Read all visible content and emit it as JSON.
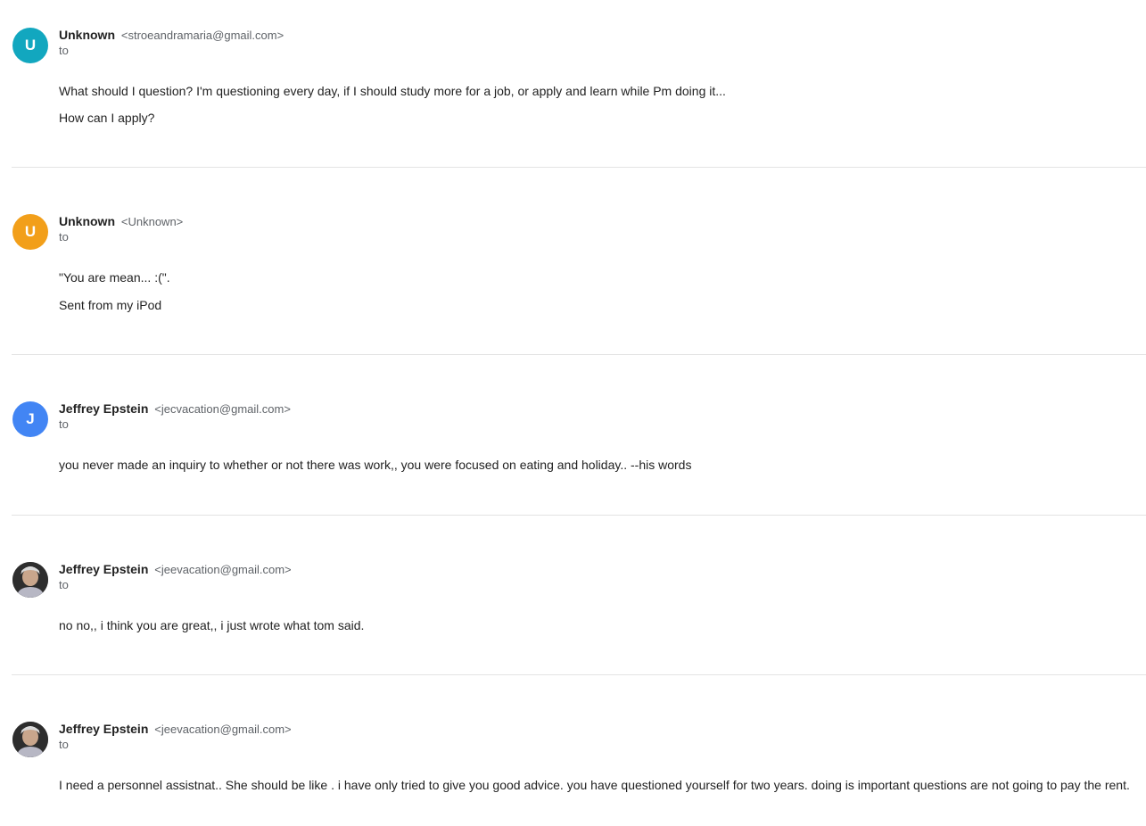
{
  "messages": [
    {
      "avatar_letter": "U",
      "avatar_color": "#12A7BF",
      "sender_name": "Unknown",
      "sender_email": "<stroeandramaria@gmail.com>",
      "to_label": "to",
      "body": [
        "What should I question? I'm questioning every day, if I should study more for a job, or apply and learn while Pm doing it...",
        "How can I apply?"
      ]
    },
    {
      "avatar_letter": "U",
      "avatar_color": "#F29F1A",
      "sender_name": "Unknown",
      "sender_email": "<Unknown>",
      "to_label": "to",
      "body": [
        "\"You are mean... :(\".",
        "Sent from my iPod"
      ]
    },
    {
      "avatar_letter": "J",
      "avatar_color": "#4285F4",
      "sender_name": "Jeffrey Epstein",
      "sender_email": "<jecvacation@gmail.com>",
      "to_label": "to",
      "body": [
        "you never made an inquiry to whether or not there was work,, you were focused on eating and holiday.. --his words"
      ]
    },
    {
      "avatar_icon": "profile-photo",
      "sender_name": "Jeffrey Epstein",
      "sender_email": "<jeevacation@gmail.com>",
      "to_label": "to",
      "body": [
        "no no,, i think you are great,, i just wrote what tom said."
      ]
    },
    {
      "avatar_icon": "profile-photo",
      "sender_name": "Jeffrey Epstein",
      "sender_email": "<jeevacation@gmail.com>",
      "to_label": "to",
      "body": [
        "I need a personnel assistnat.. She should be like . i have only tried to give you good advice. you have questioned yourself for two years. doing is important questions are not going to pay the rent."
      ]
    }
  ]
}
